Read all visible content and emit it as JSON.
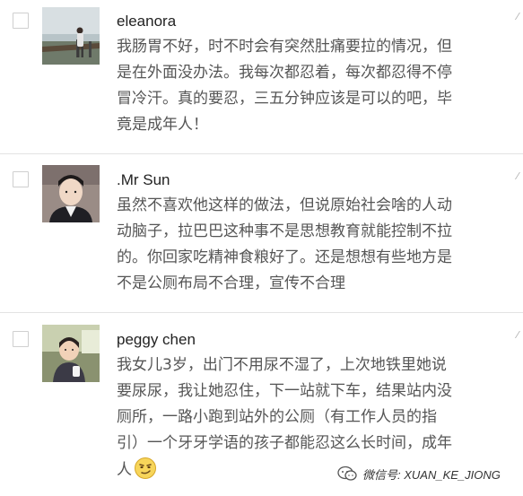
{
  "comments": [
    {
      "name": "eleanora",
      "lines": [
        "我肠胃不好，时不时会有突然肚痛要拉的情况，但",
        "是在外面没办法。我每次都忍着，每次都忍得不停",
        "冒冷汗。真的要忍，三五分钟应该是可以的吧，毕",
        "竟是成年人！"
      ],
      "avatar_icon": "person-avatar-icon"
    },
    {
      "name": ".Mr Sun",
      "lines": [
        "虽然不喜欢他这样的做法，但说原始社会啥的人动",
        "动脑子，拉巴巴这种事不是思想教育就能控制不拉",
        "的。你回家吃精神食粮好了。还是想想有些地方是",
        "不是公厕布局不合理，宣传不合理"
      ],
      "avatar_icon": "person-avatar-icon"
    },
    {
      "name": "peggy chen",
      "lines": [
        "我女儿3岁，出门不用尿不湿了，上次地铁里她说",
        "要尿尿，我让她忍住，下一站就下车，结果站内没",
        "厕所，一路小跑到站外的公厕（有工作人员的指",
        "引）一个牙牙学语的孩子都能忍这么长时间，成年",
        "人"
      ],
      "avatar_icon": "child-avatar-icon",
      "emoji_icon": "smirk-emoji-icon"
    }
  ],
  "watermark": {
    "text": "微信号: XUAN_KE_JIONG",
    "icon": "wechat-icon"
  },
  "colors": {
    "name": "#222222",
    "body": "#555555",
    "divider": "#e3e3e3"
  }
}
